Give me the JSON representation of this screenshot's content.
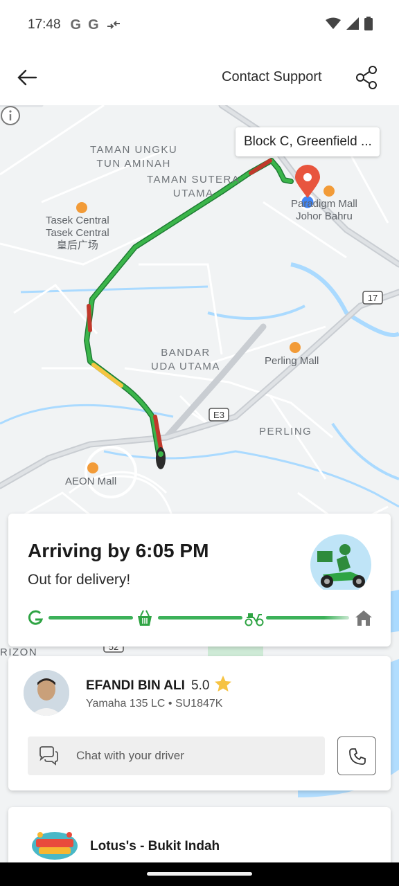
{
  "status_bar": {
    "time": "17:48",
    "indicators": [
      "G",
      "G"
    ],
    "icons": [
      "data-transfer-icon",
      "wifi-icon",
      "signal-icon",
      "battery-icon"
    ]
  },
  "header": {
    "back_icon": "arrow-left-icon",
    "support_label": "Contact Support",
    "share_icon": "share-icon"
  },
  "map": {
    "destination_label": "Block C, Greenfield ...",
    "area_labels": [
      "TAMAN UNGKU\nTUN AMINAH",
      "TAMAN SUTERA\nUTAMA",
      "BANDAR\nUDA UTAMA",
      "PERLING"
    ],
    "places": [
      {
        "name": "Tasek Central\nTasek Central\n皇后广场",
        "icon": "shopping-basket-icon"
      },
      {
        "name": "Paradigm Mall\nJohor Bahru",
        "icon": "shopping-basket-icon"
      },
      {
        "name": "Perling Mall",
        "icon": "shopping-basket-icon"
      },
      {
        "name": "AEON Mall",
        "icon": "shopping-basket-icon"
      }
    ],
    "road_shields": [
      "17",
      "E3",
      "52"
    ],
    "edge_label": "RIZON",
    "info_icon": "info-icon"
  },
  "eta": {
    "title": "Arriving by 6:05 PM",
    "subtitle": "Out for delivery!",
    "illustration": "delivery-rider-illustration",
    "progress_steps": [
      {
        "icon": "grab-logo-icon",
        "done": true
      },
      {
        "icon": "basket-icon",
        "done": true
      },
      {
        "icon": "scooter-icon",
        "done": true
      },
      {
        "icon": "home-icon",
        "done": false
      }
    ],
    "accent_color": "#00b14f",
    "inactive_color": "#777777"
  },
  "driver": {
    "name": "EFANDI BIN ALI",
    "rating": "5.0",
    "vehicle": "Yamaha 135 LC • SU1847K",
    "chat_placeholder": "Chat with your driver",
    "chat_icon": "chat-bubbles-icon",
    "call_icon": "phone-icon",
    "star_color": "#f6c343"
  },
  "store": {
    "name": "Lotus's - Bukit Indah",
    "logo": "riang-berganda-logo"
  }
}
